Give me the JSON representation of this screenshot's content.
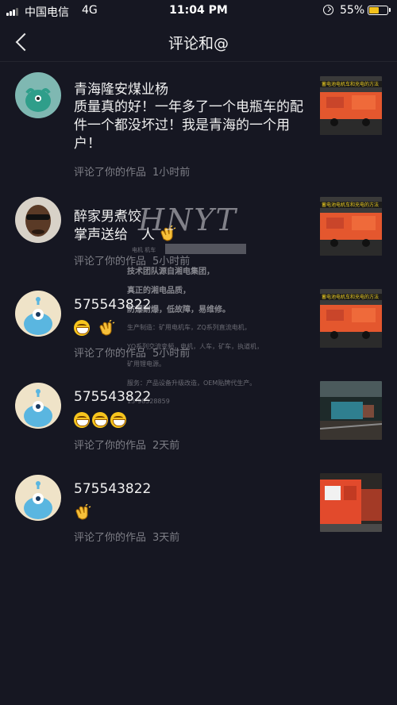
{
  "status_bar": {
    "carrier": "中国电信",
    "network": "4G",
    "time": "11:04 PM",
    "battery_percent": "55%",
    "battery_level": 0.55
  },
  "nav": {
    "title": "评论和@"
  },
  "comments": [
    {
      "username": "青海隆安煤业杨",
      "text": "质量真的好！一年多了一个电瓶车的配件一个都没坏过！我是青海的一个用户！",
      "action": "评论了你的作品",
      "time": "1小时前",
      "thumb_caption": "蓄电池电机车和充电的方法"
    },
    {
      "username": "醉家男煮饺",
      "text": "掌声送给",
      "text_suffix": "人",
      "action": "评论了你的作品",
      "time": "5小时前",
      "thumb_caption": "蓄电池电机车和充电的方法"
    },
    {
      "username": "575543822",
      "action": "评论了你的作品",
      "time": "5小时前",
      "thumb_caption": "蓄电池电机车和充电的方法"
    },
    {
      "username": "575543822",
      "action": "评论了你的作品",
      "time": "2天前"
    },
    {
      "username": "575543822",
      "action": "评论了你的作品",
      "time": "3天前"
    }
  ],
  "watermark": {
    "logo": "HNYT",
    "subline": "电机  机车",
    "line1": "技术团队源自湘电集团，",
    "line2": "真正的湘电品质，",
    "line3": "防爆耐爆，低故障，易维修。",
    "line4": "生产制造：矿用电机车，ZQ系列直流电机，",
    "line5": "YQ系列交流变频，电机，人车，矿车，执道机，",
    "line6": "矿用锂电源。",
    "line7": "服务：产品设备升级改造，OEM贴牌代生产。",
    "line8": "13-98528859"
  },
  "colors": {
    "background": "#161722",
    "muted_text": "#7d7e86",
    "battery": "#f2c11a"
  }
}
